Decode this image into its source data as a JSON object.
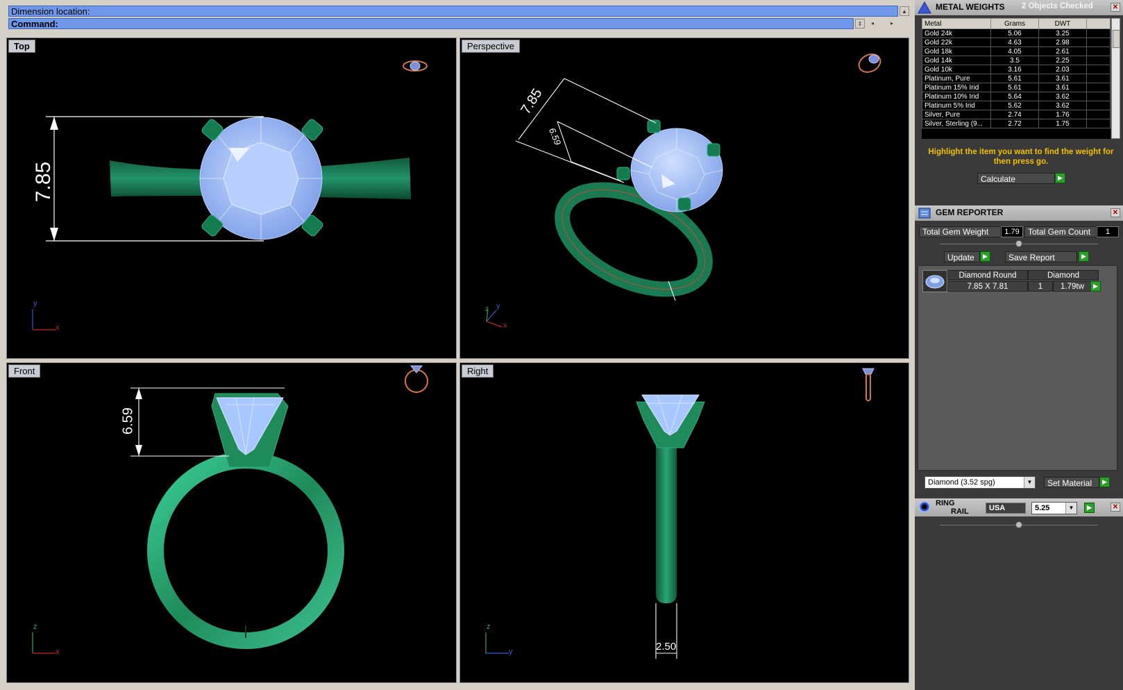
{
  "command": {
    "dimension_location": "Dimension location:",
    "command_label": "Command:"
  },
  "viewports": {
    "top": {
      "label": "Top",
      "dimension": "7.85"
    },
    "perspective": {
      "label": "Perspective",
      "dimension_large": "7.85",
      "dimension_small": "6.59"
    },
    "front": {
      "label": "Front",
      "dimension": "6.59"
    },
    "right": {
      "label": "Right",
      "dimension": "2.50"
    }
  },
  "axes": {
    "x": "x",
    "y": "y",
    "z": "z"
  },
  "metal_weights": {
    "title": "METAL WEIGHTS",
    "objects_checked": "2 Objects Checked",
    "columns": [
      "Metal",
      "Grams",
      "DWT"
    ],
    "rows": [
      {
        "metal": "Gold 24k",
        "grams": "5.06",
        "dwt": "3.25"
      },
      {
        "metal": "Gold 22k",
        "grams": "4.63",
        "dwt": "2.98"
      },
      {
        "metal": "Gold 18k",
        "grams": "4.05",
        "dwt": "2.61"
      },
      {
        "metal": "Gold 14k",
        "grams": "3.5",
        "dwt": "2.25"
      },
      {
        "metal": "Gold 10k",
        "grams": "3.16",
        "dwt": "2.03"
      },
      {
        "metal": "Platinum, Pure",
        "grams": "5.61",
        "dwt": "3.61"
      },
      {
        "metal": "Platinum 15% Irid",
        "grams": "5.61",
        "dwt": "3.61"
      },
      {
        "metal": "Platinum 10% Irid",
        "grams": "5.64",
        "dwt": "3.62"
      },
      {
        "metal": "Platinum 5% Irid",
        "grams": "5.62",
        "dwt": "3.62"
      },
      {
        "metal": "Silver, Pure",
        "grams": "2.74",
        "dwt": "1.76"
      },
      {
        "metal": "Silver, Sterling (9...",
        "grams": "2.72",
        "dwt": "1.75"
      }
    ],
    "hint": "Highlight the item you want to find the weight for then press go.",
    "calculate_label": "Calculate"
  },
  "gem_reporter": {
    "title": "GEM REPORTER",
    "total_weight_label": "Total Gem Weight",
    "total_weight": "1.79",
    "total_count_label": "Total Gem Count",
    "total_count": "1",
    "update_label": "Update",
    "save_report_label": "Save Report",
    "gem_shape": "Diamond Round",
    "gem_material": "Diamond",
    "gem_size": "7.85 X 7.81",
    "gem_qty": "1",
    "gem_weight": "1.79tw",
    "material_select": "Diamond    (3.52 spg)",
    "set_material_label": "Set Material"
  },
  "ring_rail": {
    "title_line1": "RING",
    "title_line2": "RAIL",
    "region": "USA",
    "size": "5.25"
  },
  "colors": {
    "metal": "#1f8a5a",
    "gem": "#a8c6ff",
    "command_bar": "#6f97ea",
    "hint": "#f0c000",
    "go_button": "#2aa02a"
  }
}
